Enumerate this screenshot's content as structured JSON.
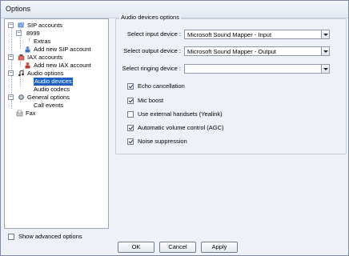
{
  "window": {
    "title": "Options"
  },
  "tree": {
    "items": [
      {
        "label": "SIP accounts"
      },
      {
        "label": "8999"
      },
      {
        "label": "Extras"
      },
      {
        "label": "Add new SIP account"
      },
      {
        "label": "IAX accounts"
      },
      {
        "label": "Add new IAX account"
      },
      {
        "label": "Audio options"
      },
      {
        "label": "Audio devices"
      },
      {
        "label": "Audio codecs"
      },
      {
        "label": "General options"
      },
      {
        "label": "Call events"
      },
      {
        "label": "Fax"
      }
    ]
  },
  "panel": {
    "title": "Audio devices options",
    "input_label": "Select input device :",
    "input_value": "Microsoft Sound Mapper - Input",
    "output_label": "Select output device :",
    "output_value": "Microsoft Sound Mapper - Output",
    "ringing_label": "Select ringing device :",
    "ringing_value": "",
    "checkboxes": [
      {
        "label": "Echo cancellation",
        "checked": true
      },
      {
        "label": "Mic boost",
        "checked": true
      },
      {
        "label": "Use external handsets (Yealink)",
        "checked": false
      },
      {
        "label": "Automatic volume control (AGC)",
        "checked": true
      },
      {
        "label": "Noise suppression",
        "checked": true
      }
    ]
  },
  "footer": {
    "show_advanced_label": "Show advanced options",
    "ok_label": "OK",
    "cancel_label": "Cancel",
    "apply_label": "Apply"
  }
}
